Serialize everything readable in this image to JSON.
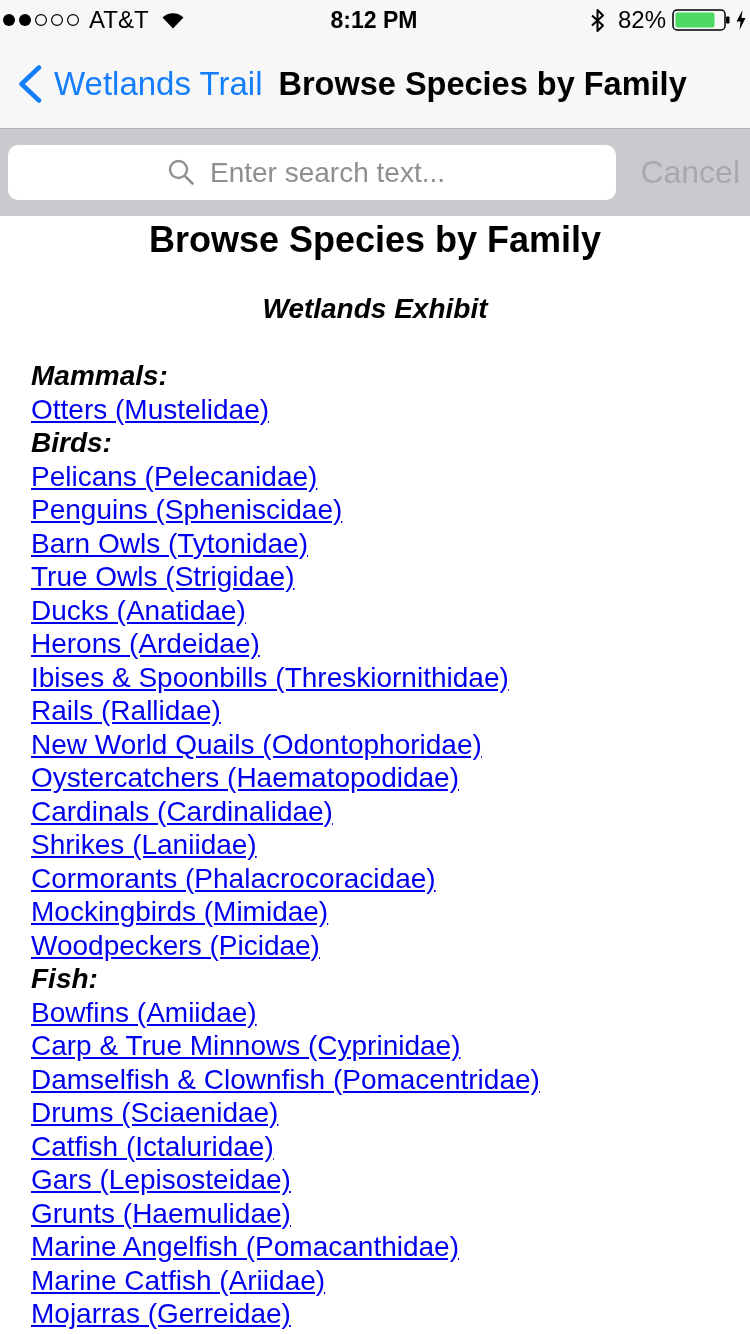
{
  "status_bar": {
    "carrier": "AT&T",
    "time": "8:12 PM",
    "battery": "82%"
  },
  "nav_bar": {
    "back": "Wetlands Trail",
    "title": "Browse Species by Family"
  },
  "search": {
    "placeholder": "Enter search text...",
    "cancel": {
      "label": "Cancel",
      "disabled": true
    }
  },
  "page": {
    "heading": "Browse Species by Family",
    "subheading": "Wetlands Exhibit",
    "groups": [
      {
        "label": "Mammals:",
        "links": [
          "Otters (Mustelidae)"
        ]
      },
      {
        "label": "Birds:",
        "links": [
          "Pelicans (Pelecanidae)",
          "Penguins (Spheniscidae)",
          "Barn Owls (Tytonidae)",
          "True Owls (Strigidae)",
          "Ducks (Anatidae)",
          "Herons (Ardeidae)",
          "Ibises & Spoonbills (Threskiornithidae)",
          "Rails (Rallidae)",
          "New World Quails (Odontophoridae)",
          "Oystercatchers (Haematopodidae)",
          "Cardinals (Cardinalidae)",
          "Shrikes (Laniidae)",
          "Cormorants (Phalacrocoracidae)",
          "Mockingbirds (Mimidae)",
          "Woodpeckers (Picidae)"
        ]
      },
      {
        "label": "Fish:",
        "links": [
          "Bowfins (Amiidae)",
          "Carp & True Minnows (Cyprinidae)",
          "Damselfish & Clownfish (Pomacentridae)",
          "Drums (Sciaenidae)",
          "Catfish (Ictaluridae)",
          "Gars (Lepisosteidae)",
          "Grunts (Haemulidae)",
          "Marine Angelfish (Pomacanthidae)",
          "Marine Catfish (Ariidae)",
          "Mojarras (Gerreidae)"
        ]
      }
    ]
  }
}
